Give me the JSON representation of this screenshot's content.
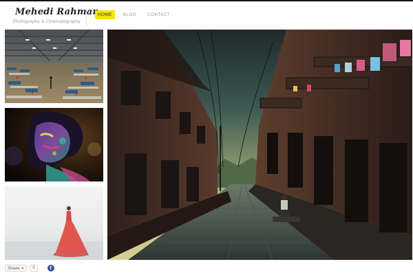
{
  "site": {
    "name": "Mehedi Rahman",
    "tagline": "Photography & Cinematography"
  },
  "nav": {
    "items": [
      {
        "label": "HOME",
        "active": true
      },
      {
        "label": "BLOG",
        "active": false
      },
      {
        "label": "CONTACT",
        "active": false
      }
    ]
  },
  "gallery": {
    "thumbnails": [
      {
        "icon": "factory-floor-photo"
      },
      {
        "icon": "color-powder-portrait-photo"
      },
      {
        "icon": "red-dress-fog-photo"
      }
    ],
    "hero": {
      "icon": "old-street-photo"
    }
  },
  "share": {
    "label": "Share",
    "count": "0",
    "facebook_glyph": "f"
  },
  "colors": {
    "accent": "#f3e500",
    "facebook": "#3b5998"
  }
}
